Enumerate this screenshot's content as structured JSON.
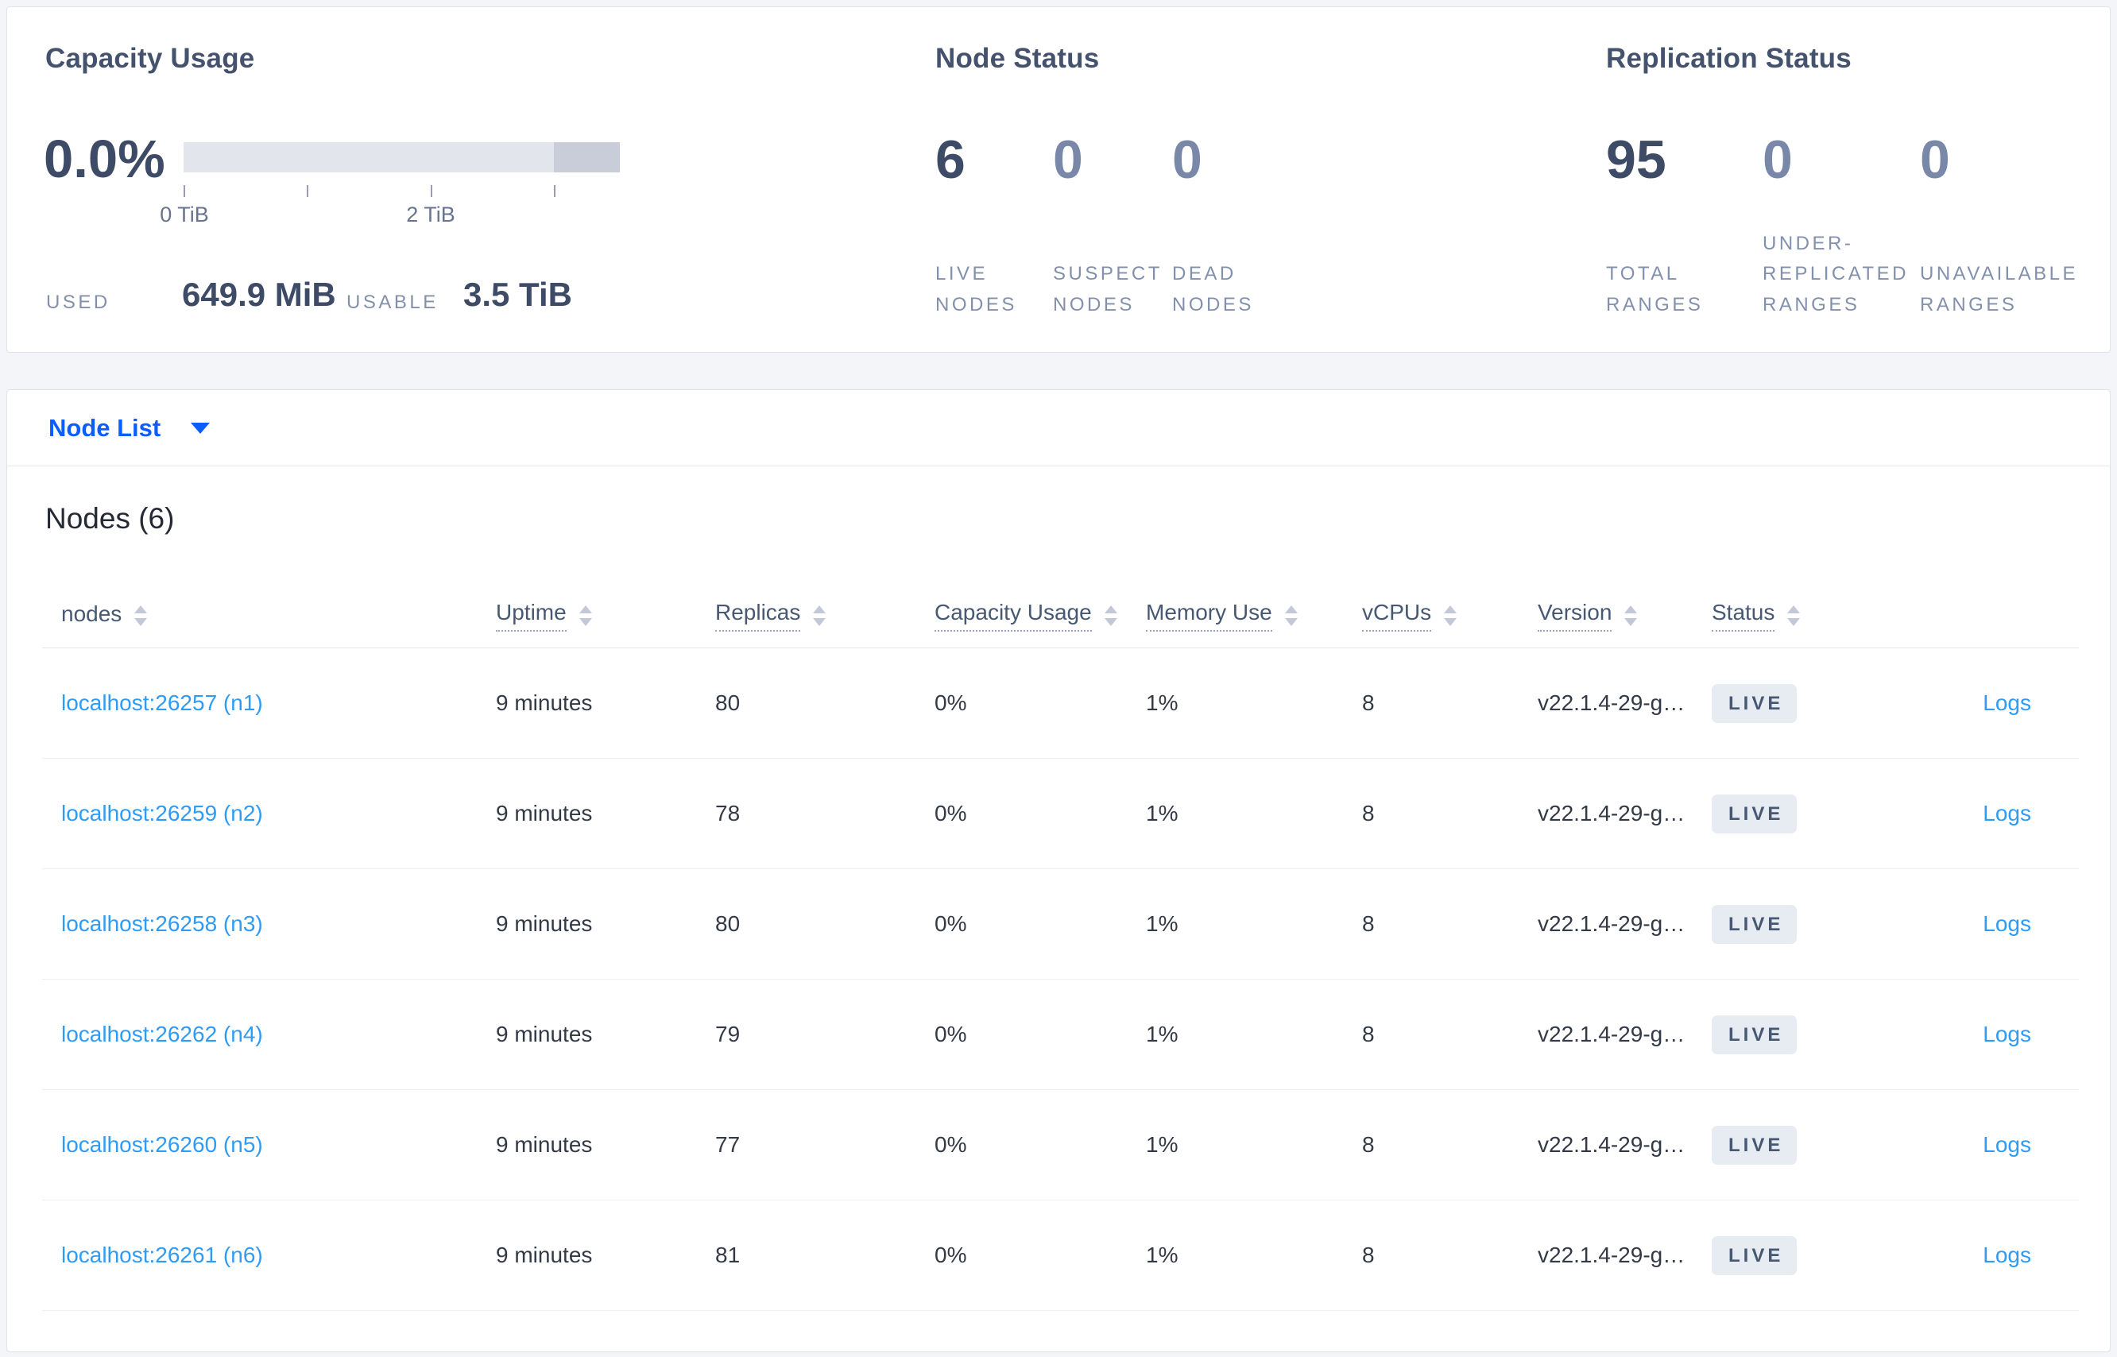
{
  "summary": {
    "capacity": {
      "title": "Capacity Usage",
      "percent": "0.0%",
      "tick_labels": [
        "0 TiB",
        "2 TiB"
      ],
      "used_label": "USED",
      "used_value": "649.9 MiB",
      "usable_label": "USABLE",
      "usable_value": "3.5 TiB"
    },
    "node_status": {
      "title": "Node Status",
      "stats": [
        {
          "value": "6",
          "label": "LIVE NODES"
        },
        {
          "value": "0",
          "label": "SUSPECT NODES"
        },
        {
          "value": "0",
          "label": "DEAD NODES"
        }
      ]
    },
    "replication_status": {
      "title": "Replication Status",
      "stats": [
        {
          "value": "95",
          "label": "TOTAL RANGES"
        },
        {
          "value": "0",
          "label": "UNDER-REPLICATED RANGES"
        },
        {
          "value": "0",
          "label": "UNAVAILABLE RANGES"
        }
      ]
    }
  },
  "view_selector": {
    "label": "Node List"
  },
  "nodes_section": {
    "title": "Nodes (6)",
    "columns": [
      "nodes",
      "Uptime",
      "Replicas",
      "Capacity Usage",
      "Memory Use",
      "vCPUs",
      "Version",
      "Status"
    ],
    "rows": [
      {
        "node": "localhost:26257 (n1)",
        "uptime": "9 minutes",
        "replicas": "80",
        "capacity": "0%",
        "memory": "1%",
        "vcpus": "8",
        "version": "v22.1.4-29-g…",
        "status": "LIVE",
        "logs": "Logs"
      },
      {
        "node": "localhost:26259 (n2)",
        "uptime": "9 minutes",
        "replicas": "78",
        "capacity": "0%",
        "memory": "1%",
        "vcpus": "8",
        "version": "v22.1.4-29-g…",
        "status": "LIVE",
        "logs": "Logs"
      },
      {
        "node": "localhost:26258 (n3)",
        "uptime": "9 minutes",
        "replicas": "80",
        "capacity": "0%",
        "memory": "1%",
        "vcpus": "8",
        "version": "v22.1.4-29-g…",
        "status": "LIVE",
        "logs": "Logs"
      },
      {
        "node": "localhost:26262 (n4)",
        "uptime": "9 minutes",
        "replicas": "79",
        "capacity": "0%",
        "memory": "1%",
        "vcpus": "8",
        "version": "v22.1.4-29-g…",
        "status": "LIVE",
        "logs": "Logs"
      },
      {
        "node": "localhost:26260 (n5)",
        "uptime": "9 minutes",
        "replicas": "77",
        "capacity": "0%",
        "memory": "1%",
        "vcpus": "8",
        "version": "v22.1.4-29-g…",
        "status": "LIVE",
        "logs": "Logs"
      },
      {
        "node": "localhost:26261 (n6)",
        "uptime": "9 minutes",
        "replicas": "81",
        "capacity": "0%",
        "memory": "1%",
        "vcpus": "8",
        "version": "v22.1.4-29-g…",
        "status": "LIVE",
        "logs": "Logs"
      }
    ]
  },
  "colors": {
    "page_bg": "#f4f5f9",
    "card_border": "#dfe3ea",
    "title_slate": "#45526e",
    "number_dark": "#3e4b66",
    "number_muted": "#7987a9",
    "label_muted": "#8290ab",
    "cell_text": "#333a46",
    "link_blue": "#2e9bf5",
    "selector_blue": "#0b5dff",
    "badge_bg": "#e7ebf2",
    "badge_text": "#475872",
    "bar_light": "#e3e5ec",
    "bar_dark": "#c9cdd9"
  }
}
